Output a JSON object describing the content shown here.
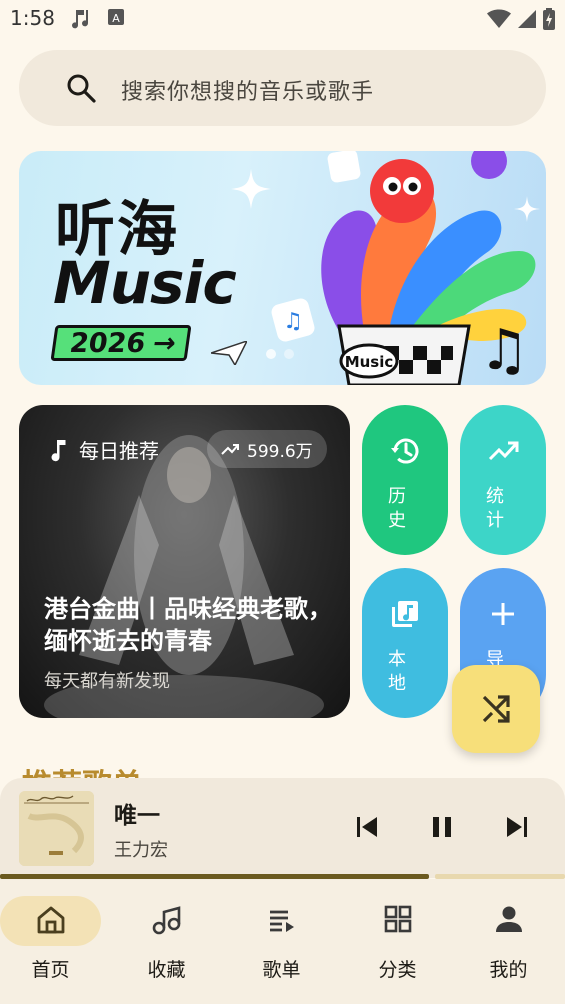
{
  "status": {
    "time": "1:58"
  },
  "search": {
    "placeholder": "搜索你想搜的音乐或歌手"
  },
  "banner": {
    "title_line1": "听海",
    "title_line2": "Music",
    "year": "2026",
    "arrow": "→",
    "cup_label": "Music"
  },
  "daily": {
    "label": "每日推荐",
    "play_count": "599.6万",
    "title": "港台金曲丨品味经典老歌，缅怀逝去的青春",
    "subtitle": "每天都有新发现"
  },
  "quick_actions": [
    {
      "label": "历史",
      "icon": "history-icon",
      "color": "#1fc77f"
    },
    {
      "label": "统计",
      "icon": "trending-icon",
      "color": "#3dd5c8"
    },
    {
      "label": "本地",
      "icon": "library-music-icon",
      "color": "#3fbde0"
    },
    {
      "label": "导入",
      "icon": "plus-icon",
      "color": "#5aa3f2"
    }
  ],
  "section": {
    "title": "推荐歌单"
  },
  "player": {
    "title": "唯一",
    "artist": "王力宏",
    "progress": 0.76
  },
  "nav": {
    "items": [
      {
        "label": "首页",
        "icon": "home-icon",
        "active": true
      },
      {
        "label": "收藏",
        "icon": "music-note-icon",
        "active": false
      },
      {
        "label": "歌单",
        "icon": "playlist-icon",
        "active": false
      },
      {
        "label": "分类",
        "icon": "grid-icon",
        "active": false
      },
      {
        "label": "我的",
        "icon": "person-icon",
        "active": false
      }
    ]
  },
  "colors": {
    "accent": "#f7df7a",
    "background": "#fdf7ec",
    "progress": "#6b5a1f"
  }
}
